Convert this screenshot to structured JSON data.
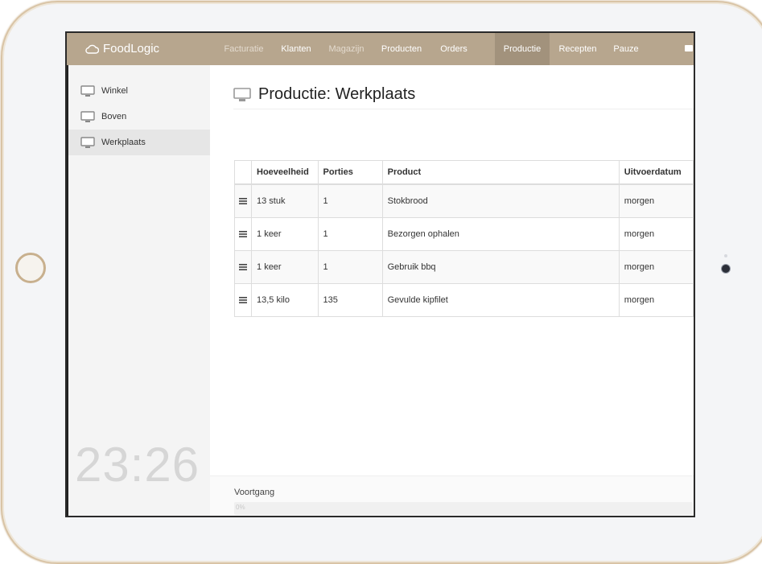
{
  "app": {
    "brand": "FoodLogic"
  },
  "nav": {
    "items": [
      {
        "label": "Facturatie",
        "state": "muted"
      },
      {
        "label": "Klanten",
        "state": "normal"
      },
      {
        "label": "Magazijn",
        "state": "muted"
      },
      {
        "label": "Producten",
        "state": "normal"
      },
      {
        "label": "Orders",
        "state": "normal"
      },
      {
        "label": "Productie",
        "state": "active"
      },
      {
        "label": "Recepten",
        "state": "normal"
      },
      {
        "label": "Pauze",
        "state": "normal"
      }
    ]
  },
  "sidebar": {
    "items": [
      {
        "label": "Winkel",
        "icon": "monitor-icon",
        "active": false
      },
      {
        "label": "Boven",
        "icon": "monitor-icon",
        "active": false
      },
      {
        "label": "Werkplaats",
        "icon": "monitor-icon",
        "active": true
      }
    ],
    "clock": "23:26"
  },
  "main": {
    "title": "Productie: Werkplaats",
    "table": {
      "headers": [
        "",
        "Hoeveelheid",
        "Porties",
        "Product",
        "Uitvoerdatum"
      ],
      "rows": [
        {
          "hoeveelheid": "13 stuk",
          "porties": "1",
          "product": "Stokbrood",
          "uitvoerdatum": "morgen"
        },
        {
          "hoeveelheid": "1 keer",
          "porties": "1",
          "product": "Bezorgen ophalen",
          "uitvoerdatum": "morgen"
        },
        {
          "hoeveelheid": "1 keer",
          "porties": "1",
          "product": "Gebruik bbq",
          "uitvoerdatum": "morgen"
        },
        {
          "hoeveelheid": "13,5 kilo",
          "porties": "135",
          "product": "Gevulde kipfilet",
          "uitvoerdatum": "morgen"
        }
      ]
    },
    "progress": {
      "label": "Voortgang",
      "percent": 0,
      "text": "0%"
    }
  },
  "colors": {
    "accent": "#b7a68e",
    "accent_active": "#a2927c",
    "frame": "#d9c4a6"
  }
}
